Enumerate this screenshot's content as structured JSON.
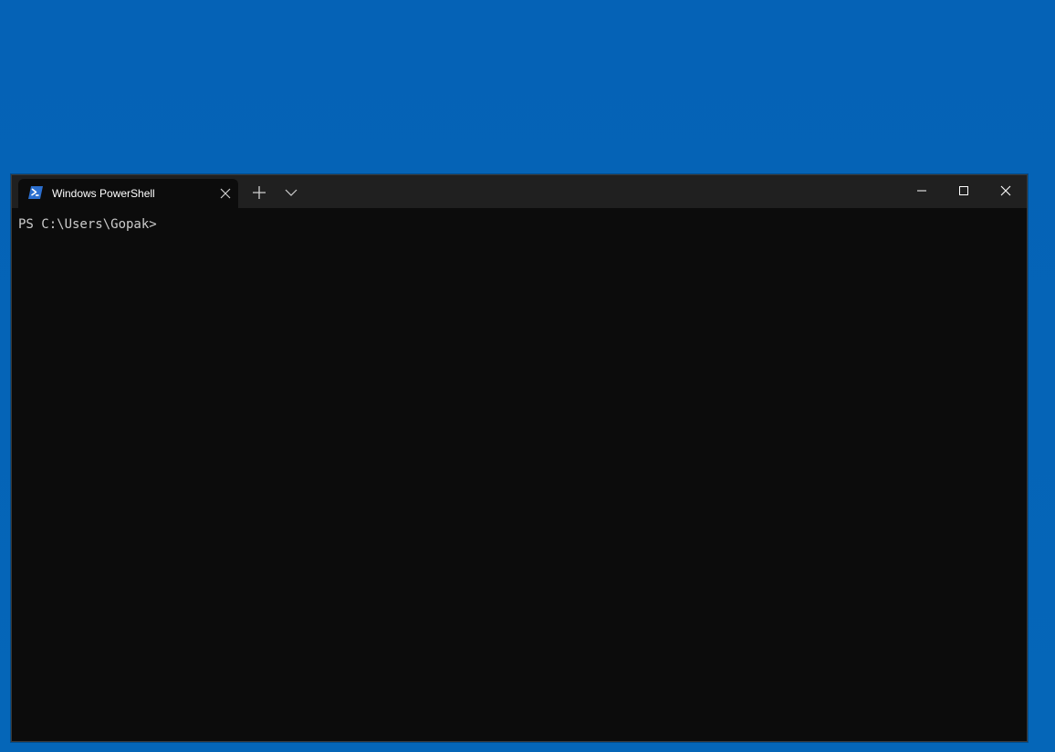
{
  "window": {
    "tab": {
      "title": "Windows PowerShell",
      "icon": "powershell-icon"
    },
    "titlebar_icons": {
      "close_tab": "close-icon",
      "new_tab": "plus-icon",
      "dropdown": "chevron-down-icon",
      "minimize": "minimize-icon",
      "maximize": "maximize-icon",
      "close_window": "close-icon"
    }
  },
  "console": {
    "prompt": "PS C:\\Users\\Gopak>"
  },
  "colors": {
    "desktop_background": "#0563b5",
    "titlebar": "#202020",
    "console_background": "#0c0c0c",
    "console_text": "#cccccc",
    "powershell_icon": "#2b6fcf"
  }
}
